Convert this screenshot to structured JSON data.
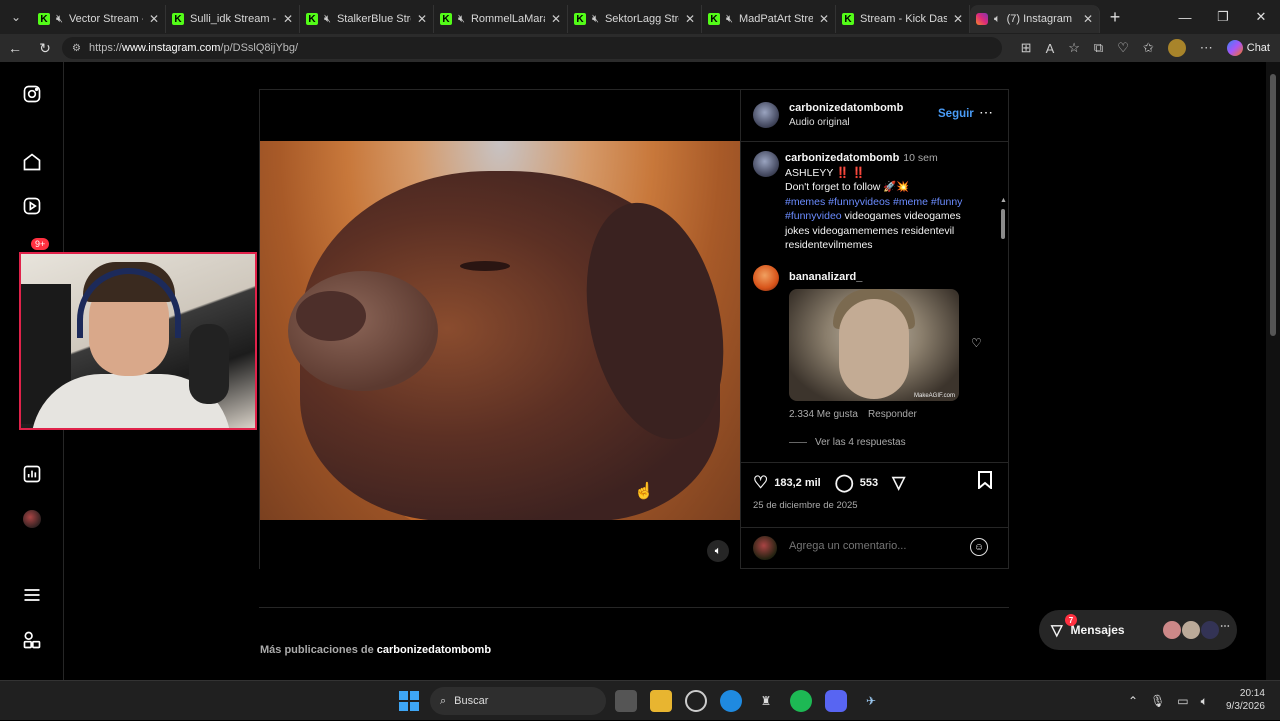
{
  "browser": {
    "tabs": [
      {
        "title": "Vector Stream -",
        "type": "kick",
        "muted": true
      },
      {
        "title": "Sulli_idk Stream - W",
        "type": "kick",
        "muted": false
      },
      {
        "title": "StalkerBlue Strea",
        "type": "kick",
        "muted": true
      },
      {
        "title": "RommelLaMara",
        "type": "kick",
        "muted": true
      },
      {
        "title": "SektorLagg Strea",
        "type": "kick",
        "muted": true
      },
      {
        "title": "MadPatArt Strea",
        "type": "kick",
        "muted": true
      },
      {
        "title": "Stream - Kick Dashb",
        "type": "kick",
        "muted": false
      },
      {
        "title": "(7) Instagram",
        "type": "instagram",
        "muted": false,
        "active": true
      }
    ],
    "url_prefix": "https://",
    "url_host": "www.instagram.com",
    "url_path": "/p/DSslQ8ijYbg/",
    "chat_label": "Chat"
  },
  "nav": {
    "notification_badge": "9+"
  },
  "post": {
    "author": "carbonizedatombomb",
    "audio": "Audio original",
    "follow_label": "Seguir",
    "caption_user": "carbonizedatombomb",
    "caption_time": "10 sem",
    "caption_line1": "ASHLEYY ‼️ ‼️",
    "caption_line2": "Don't forget to follow 🚀💥",
    "hashtags": "#memes #funnyvideos #meme #funny #funnyvideo",
    "caption_rest": " videogames videogames jokes videogamememes residentevil residentevilmemes",
    "comment": {
      "user": "bananalizard_",
      "gif_watermark": "MakeAGIF.com",
      "likes": "2.334 Me gusta",
      "reply_label": "Responder",
      "view_replies": "Ver las 4 respuestas"
    },
    "like_count": "183,2 mil",
    "comment_count": "553",
    "date": "25 de diciembre de 2025",
    "comment_placeholder": "Agrega un comentario..."
  },
  "more_posts": {
    "prefix": "Más publicaciones de ",
    "user": "carbonizedatombomb"
  },
  "messages": {
    "label": "Mensajes",
    "badge": "7"
  },
  "taskbar": {
    "search_label": "Buscar",
    "time": "20:14",
    "date": "9/3/2026"
  },
  "colors": {
    "accent_blue": "#4a9cf6",
    "hashtag": "#6b8cff",
    "badge_red": "#ff3040",
    "kick_green": "#53fc18",
    "webcam_border": "#e0224a"
  }
}
